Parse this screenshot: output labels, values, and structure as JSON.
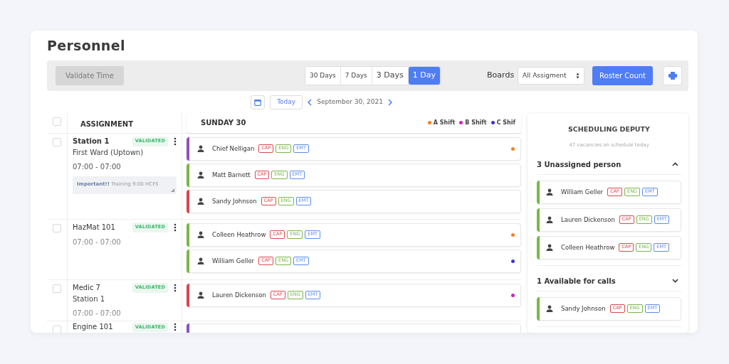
{
  "title": "Personnel",
  "toolbar": {
    "validate_button": {
      "label": "Validate Time",
      "disabled": true
    },
    "range_tabs": [
      {
        "label": "30 Days",
        "selected": false,
        "kind": "small"
      },
      {
        "label": "7 Days",
        "selected": false,
        "kind": "small"
      },
      {
        "label": "3 Days",
        "selected": false,
        "kind": "large"
      },
      {
        "label": "1 Day",
        "selected": true,
        "kind": "large"
      }
    ],
    "boards_label": "Boards",
    "boards_select": "All Assigment",
    "roster_button": "Roster Count"
  },
  "date_nav": {
    "today_button": "Today",
    "date": "September 30, 2021"
  },
  "table": {
    "select_all_checked": false,
    "assignment_header": "ASSIGNMENT",
    "day_header": "SUNDAY 30",
    "legend": [
      {
        "label": "A Shift",
        "color": "#f5821f"
      },
      {
        "label": "B Shift",
        "color": "#d41fc4"
      },
      {
        "label": "C Shif",
        "color": "#3d35d6"
      }
    ],
    "rows": [
      {
        "checked": false,
        "name": "Station 1",
        "bold": true,
        "subtitle": "First Ward (Uptown)",
        "time": "07:00 - 07:00",
        "status": "VALIDATED",
        "note": "**Important!!** Training 9:00 HCFS",
        "people": [
          {
            "name": "Chief Nelligan",
            "color": "#8e4fc2",
            "tags": [
              {
                "label": "CAP",
                "color": "#e0474c"
              },
              {
                "label": "ENG",
                "color": "#7ab648"
              },
              {
                "label": "EMT",
                "color": "#5b8def"
              }
            ],
            "shift": {
              "color": "#f5821f"
            }
          },
          {
            "name": "Matt Barnett",
            "color": "#7ab648",
            "tags": [
              {
                "label": "CAP",
                "color": "#e0474c"
              },
              {
                "label": "ENG",
                "color": "#7ab648"
              },
              {
                "label": "EMT",
                "color": "#5b8def"
              }
            ]
          },
          {
            "name": "Sandy Johnson",
            "color": "#d9464b",
            "tags": [
              {
                "label": "CAP",
                "color": "#e0474c"
              },
              {
                "label": "ENG",
                "color": "#7ab648"
              },
              {
                "label": "EMT",
                "color": "#5b8def"
              }
            ]
          }
        ]
      },
      {
        "checked": false,
        "name": "HazMat 101",
        "bold": false,
        "time": "07:00 - 07:00",
        "status": "VALIDATED",
        "people": [
          {
            "name": "Colleen Heathrow",
            "color": "#7ab648",
            "tags": [
              {
                "label": "CAP",
                "color": "#e0474c"
              },
              {
                "label": "ENG",
                "color": "#7ab648"
              },
              {
                "label": "EMT",
                "color": "#5b8def"
              }
            ],
            "shift": {
              "color": "#f5821f"
            }
          },
          {
            "name": "William Geller",
            "color": "#7ab648",
            "tags": [
              {
                "label": "CAP",
                "color": "#e0474c"
              },
              {
                "label": "ENG",
                "color": "#7ab648"
              },
              {
                "label": "EMT",
                "color": "#5b8def"
              }
            ],
            "shift": {
              "color": "#3d35d6"
            }
          }
        ]
      },
      {
        "checked": false,
        "name": "Medic 7",
        "bold": false,
        "subtitle": "Station 1",
        "time": "07:00 - 07:00",
        "status": "VALIDATED",
        "people": [
          {
            "name": "Lauren Dickenson",
            "color": "#d9464b",
            "tags": [
              {
                "label": "CAP",
                "color": "#e0474c"
              },
              {
                "label": "ENG",
                "color": "#7ab648"
              },
              {
                "label": "EMT",
                "color": "#5b8def"
              }
            ],
            "shift": {
              "color": "#d41fc4"
            }
          }
        ]
      },
      {
        "checked": false,
        "name": "Engine 101",
        "bold": false,
        "status": "VALIDATED",
        "people": [
          {
            "color": "#8e4fc2"
          }
        ]
      }
    ]
  },
  "deputy": {
    "title": "SCHEDULING DEPUTY",
    "subtitle": "47 vacancies on schedule today",
    "sections": [
      {
        "title": "3 Unassigned person",
        "expanded": true,
        "people": [
          {
            "name": "William Geller",
            "color": "#7ab648",
            "tags": [
              {
                "label": "CAP",
                "color": "#e0474c"
              },
              {
                "label": "ENG",
                "color": "#7ab648"
              },
              {
                "label": "EMT",
                "color": "#5b8def"
              }
            ]
          },
          {
            "name": "Lauren Dickenson",
            "color": "#7ab648",
            "tags": [
              {
                "label": "CAP",
                "color": "#e0474c"
              },
              {
                "label": "ENG",
                "color": "#7ab648"
              },
              {
                "label": "EMT",
                "color": "#5b8def"
              }
            ]
          },
          {
            "name": "Colleen Heathrow",
            "color": "#7ab648",
            "tags": [
              {
                "label": "CAP",
                "color": "#e0474c"
              },
              {
                "label": "ENG",
                "color": "#7ab648"
              },
              {
                "label": "EMT",
                "color": "#5b8def"
              }
            ]
          }
        ]
      },
      {
        "title": "1 Available for calls",
        "expanded": false,
        "people": [
          {
            "name": "Sandy Johnson",
            "color": "#7ab648",
            "tags": [
              {
                "label": "CAP",
                "color": "#e0474c"
              },
              {
                "label": "ENG",
                "color": "#7ab648"
              },
              {
                "label": "EMT",
                "color": "#5b8def"
              }
            ]
          }
        ]
      }
    ]
  }
}
